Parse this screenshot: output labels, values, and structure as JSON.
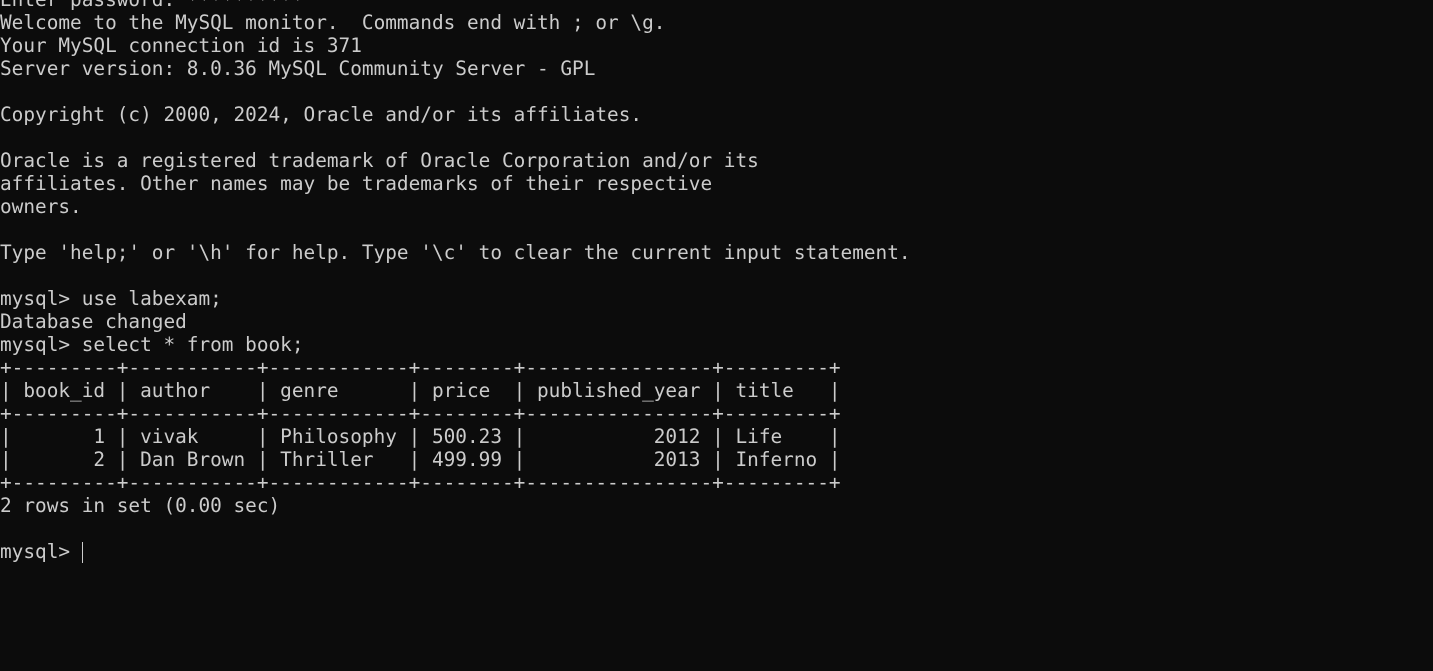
{
  "terminal": {
    "colors": {
      "background": "#0c0c0c",
      "foreground": "#cccccc"
    },
    "lines": [
      "Enter password: **********",
      "Welcome to the MySQL monitor.  Commands end with ; or \\g.",
      "Your MySQL connection id is 371",
      "Server version: 8.0.36 MySQL Community Server - GPL",
      "",
      "Copyright (c) 2000, 2024, Oracle and/or its affiliates.",
      "",
      "Oracle is a registered trademark of Oracle Corporation and/or its",
      "affiliates. Other names may be trademarks of their respective",
      "owners.",
      "",
      "Type 'help;' or '\\h' for help. Type '\\c' to clear the current input statement.",
      "",
      "mysql> use labexam;",
      "Database changed",
      "mysql> select * from book;",
      "+---------+-----------+------------+--------+----------------+---------+",
      "| book_id | author    | genre      | price  | published_year | title   |",
      "+---------+-----------+------------+--------+----------------+---------+",
      "|       1 | vivak     | Philosophy | 500.23 |           2012 | Life    |",
      "|       2 | Dan Brown | Thriller   | 499.99 |           2013 | Inferno |",
      "+---------+-----------+------------+--------+----------------+---------+",
      "2 rows in set (0.00 sec)",
      ""
    ],
    "prompt": "mysql> ",
    "input_value": ""
  }
}
